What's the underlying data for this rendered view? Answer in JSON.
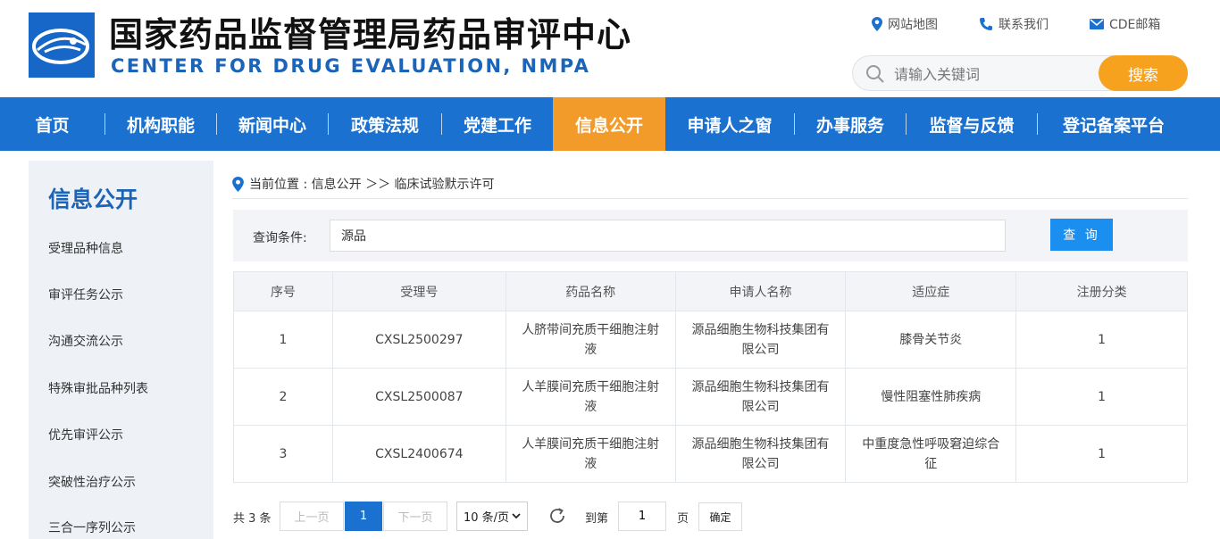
{
  "header": {
    "title_cn": "国家药品监督管理局药品审评中心",
    "title_en": "CENTER FOR DRUG EVALUATION, NMPA",
    "links": [
      {
        "label": "网站地图",
        "icon": "map-pin-icon"
      },
      {
        "label": "联系我们",
        "icon": "phone-icon"
      },
      {
        "label": "CDE邮箱",
        "icon": "mail-icon"
      }
    ],
    "search": {
      "placeholder": "请输入关键词",
      "button": "搜索"
    }
  },
  "nav": {
    "items": [
      "首页",
      "机构职能",
      "新闻中心",
      "政策法规",
      "党建工作",
      "信息公开",
      "申请人之窗",
      "办事服务",
      "监督与反馈",
      "登记备案平台"
    ],
    "active_index": 5
  },
  "sidebar": {
    "title": "信息公开",
    "items": [
      "受理品种信息",
      "审评任务公示",
      "沟通交流公示",
      "特殊审批品种列表",
      "优先审评公示",
      "突破性治疗公示",
      "三合一序列公示"
    ]
  },
  "breadcrumb": {
    "text": "当前位置 : 信息公开 ＞＞ 临床试验默示许可"
  },
  "query": {
    "label": "查询条件:",
    "value": "源品",
    "button": "查 询"
  },
  "table": {
    "headers": [
      "序号",
      "受理号",
      "药品名称",
      "申请人名称",
      "适应症",
      "注册分类"
    ],
    "rows": [
      [
        "1",
        "CXSL2500297",
        "人脐带间充质干细胞注射液",
        "源品细胞生物科技集团有限公司",
        "膝骨关节炎",
        "1"
      ],
      [
        "2",
        "CXSL2500087",
        "人羊膜间充质干细胞注射液",
        "源品细胞生物科技集团有限公司",
        "慢性阻塞性肺疾病",
        "1"
      ],
      [
        "3",
        "CXSL2400674",
        "人羊膜间充质干细胞注射液",
        "源品细胞生物科技集团有限公司",
        "中重度急性呼吸窘迫综合征",
        "1"
      ]
    ]
  },
  "pagination": {
    "total": "共 3 条",
    "prev": "上一页",
    "current": "1",
    "next": "下一页",
    "page_size": "10 条/页",
    "goto_label": "到第",
    "goto_value": "1",
    "page_label": "页",
    "confirm": "确定"
  },
  "colors": {
    "brand_blue": "#1a71cf",
    "accent_orange": "#f29b2b",
    "search_orange": "#f6a21f"
  }
}
